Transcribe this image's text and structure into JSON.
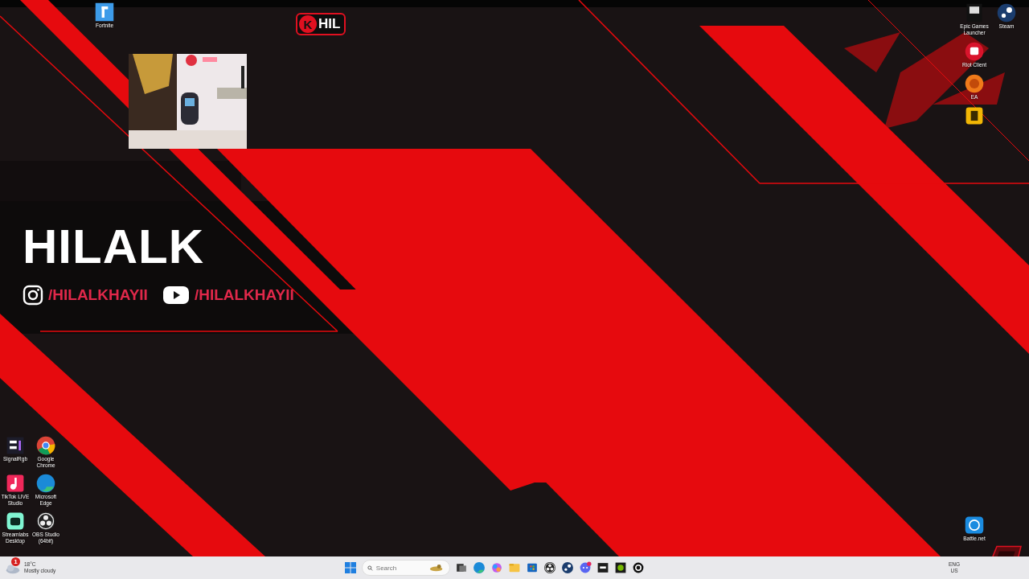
{
  "top_icons": [
    {
      "kind": "fortnite",
      "label": "Fortnite"
    }
  ],
  "right_icons": [
    {
      "kind": "epic",
      "label": "Epic Games Launcher"
    },
    {
      "kind": "steam",
      "label": "Steam"
    },
    {
      "kind": "riot",
      "label": "Riot Client"
    },
    {
      "kind": "ea",
      "label": "EA"
    },
    {
      "kind": "rockstar"
    }
  ],
  "corner_icons": [
    {
      "kind": "battlenet",
      "label": "Battle.net"
    }
  ],
  "left_icons": [
    {
      "kind": "signalrgb",
      "label": "SignalRgb"
    },
    {
      "kind": "chrome",
      "label": "Google Chrome"
    },
    {
      "kind": "tiktok",
      "label": "TikTok LIVE Studio"
    },
    {
      "kind": "edge",
      "label": "Microsoft Edge"
    },
    {
      "kind": "streamlabs",
      "label": "Streamlabs Desktop"
    },
    {
      "kind": "obs",
      "label": "OBS Studio (64bit)"
    }
  ],
  "overlay": {
    "logo_badge": "K",
    "logo_text": "HIL",
    "title": "HILALK",
    "handles": [
      {
        "kind": "instagram",
        "text": "/HILALKHAYII"
      },
      {
        "kind": "youtube",
        "text": "/HILALKHAYII"
      }
    ]
  },
  "taskbar": {
    "weather": {
      "alerts": "1",
      "temperature": "18°C",
      "condition": "Mostly cloudy"
    },
    "search": {
      "placeholder": "Search"
    },
    "apps": [
      {
        "kind": "taskview"
      },
      {
        "kind": "edge"
      },
      {
        "kind": "copilot"
      },
      {
        "kind": "explorer"
      },
      {
        "kind": "store"
      },
      {
        "kind": "obs"
      },
      {
        "kind": "steam"
      },
      {
        "kind": "discord"
      },
      {
        "kind": "terminal"
      },
      {
        "kind": "nvidia"
      },
      {
        "kind": "ghub"
      }
    ],
    "language": {
      "code": "ENG",
      "region": "US"
    }
  }
}
